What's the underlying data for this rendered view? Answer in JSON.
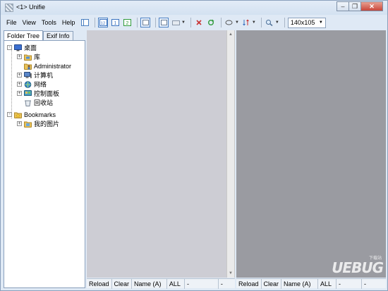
{
  "window": {
    "title": "<1> Unifie"
  },
  "menu": [
    "File",
    "View",
    "Tools",
    "Help"
  ],
  "toolbar": {
    "size_value": "140x105"
  },
  "tabs": [
    {
      "label": "Folder Tree"
    },
    {
      "label": "Exif Info"
    }
  ],
  "tree": [
    {
      "label": "桌面",
      "icon": "desktop-icon",
      "color": "#3b6fd0",
      "expander": "-"
    },
    {
      "label": "库",
      "icon": "library-icon",
      "color": "#e8c25a",
      "expander": "+"
    },
    {
      "label": "Administrator",
      "icon": "user-folder-icon",
      "color": "#d9a93a",
      "expander": ""
    },
    {
      "label": "计算机",
      "icon": "computer-icon",
      "color": "#5a86c8",
      "expander": "+"
    },
    {
      "label": "网络",
      "icon": "network-icon",
      "color": "#3a8fd0",
      "expander": "+"
    },
    {
      "label": "控制面板",
      "icon": "control-panel-icon",
      "color": "#4aa0c8",
      "expander": "+"
    },
    {
      "label": "回收站",
      "icon": "recycle-bin-icon",
      "color": "#b7bec7",
      "expander": ""
    },
    {
      "label": "Bookmarks",
      "icon": "bookmark-star-icon",
      "color": "#f0b820",
      "expander": "-"
    },
    {
      "label": "我的图片",
      "icon": "pictures-folder-icon",
      "color": "#e8c25a",
      "expander": "+"
    }
  ],
  "status_left": {
    "reload": "Reload",
    "clear": "Clear",
    "sort": "Name (A)",
    "filter": "ALL",
    "extra1": "-",
    "extra2": "-"
  },
  "status_right": {
    "reload": "Reload",
    "clear": "Clear",
    "sort": "Name (A)",
    "filter": "ALL",
    "extra1": "-",
    "extra2": "-"
  },
  "watermark": {
    "big": "UEBUG",
    "small": "下载站"
  },
  "colors": {
    "left_pane": "#cdcdd4",
    "right_pane": "#9a9ba1",
    "frame": "#dfe9f5"
  }
}
